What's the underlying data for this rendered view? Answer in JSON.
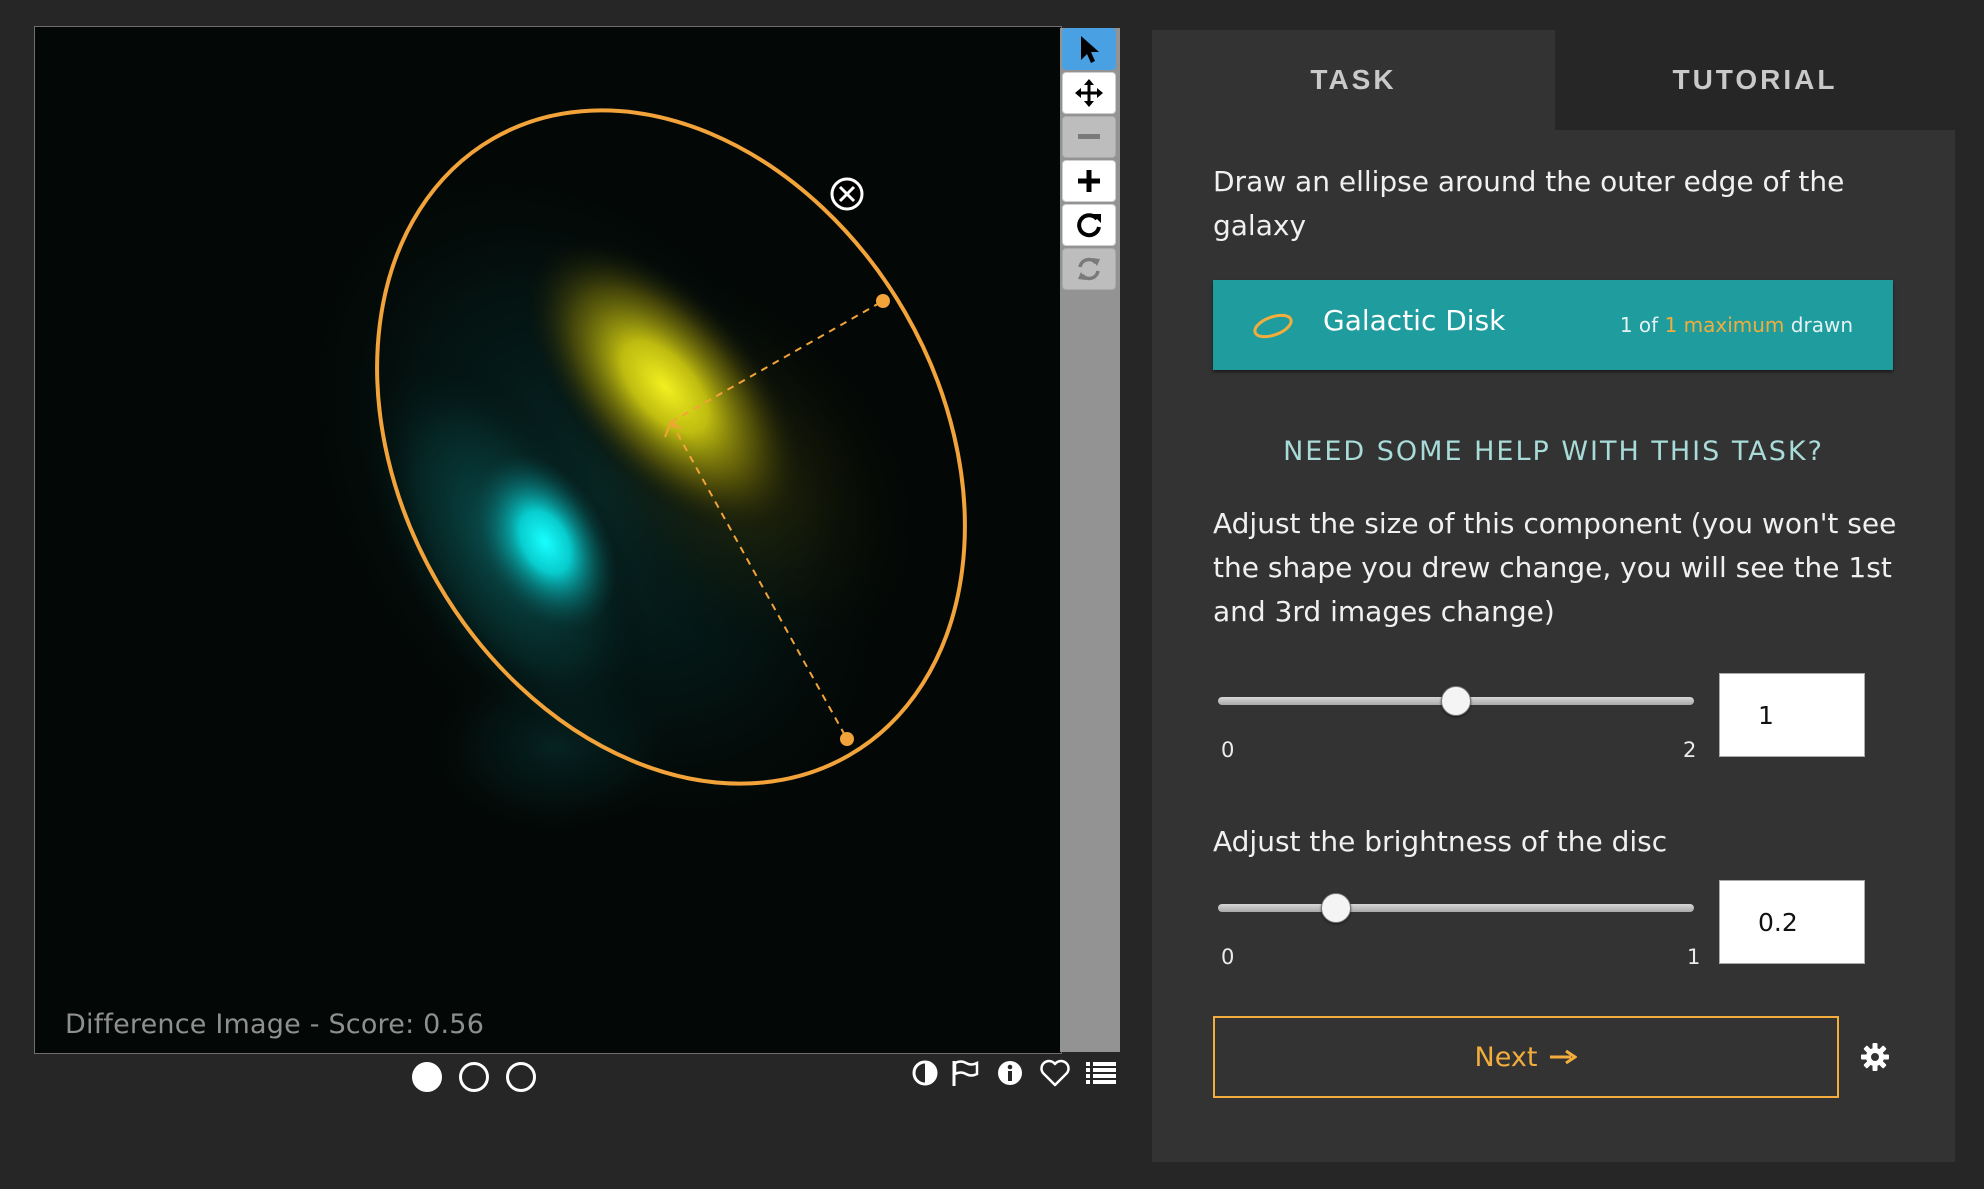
{
  "viewer": {
    "caption": "Difference Image - Score: 0.56",
    "frames": [
      {
        "name": "frame-1",
        "selected": true
      },
      {
        "name": "frame-2",
        "selected": false
      },
      {
        "name": "frame-3",
        "selected": false
      }
    ]
  },
  "toolbar": {
    "tools": [
      {
        "icon": "pointer-icon",
        "state": "active"
      },
      {
        "icon": "move-icon",
        "state": "enabled"
      },
      {
        "icon": "zoom-out-icon",
        "state": "disabled"
      },
      {
        "icon": "zoom-in-icon",
        "state": "enabled"
      },
      {
        "icon": "rotate-icon",
        "state": "enabled"
      },
      {
        "icon": "reset-icon",
        "state": "disabled"
      }
    ]
  },
  "bottom_icons": [
    "invert-icon",
    "flag-icon",
    "info-icon",
    "heart-icon",
    "list-icon"
  ],
  "tabs": {
    "task": "TASK",
    "tutorial": "TUTORIAL"
  },
  "task": {
    "instruction": "Draw an ellipse around the outer edge of the galaxy",
    "tool": {
      "label": "Galactic Disk",
      "count_prefix": "1 of",
      "count_highlight": "1 maximum",
      "count_suffix": "drawn",
      "color": "#1e9c9e"
    },
    "help_link": "NEED SOME HELP WITH THIS TASK?",
    "size_question": "Adjust the size of this component (you won't see the shape you drew change, you will see the 1st and 3rd images change)",
    "size_slider": {
      "min": "0",
      "max": "2",
      "value": "1"
    },
    "brightness_question": "Adjust the brightness of the disc",
    "brightness_slider": {
      "min": "0",
      "max": "1",
      "value": "0.2"
    },
    "next_label": "Next",
    "accent": "#f2ad3d"
  }
}
